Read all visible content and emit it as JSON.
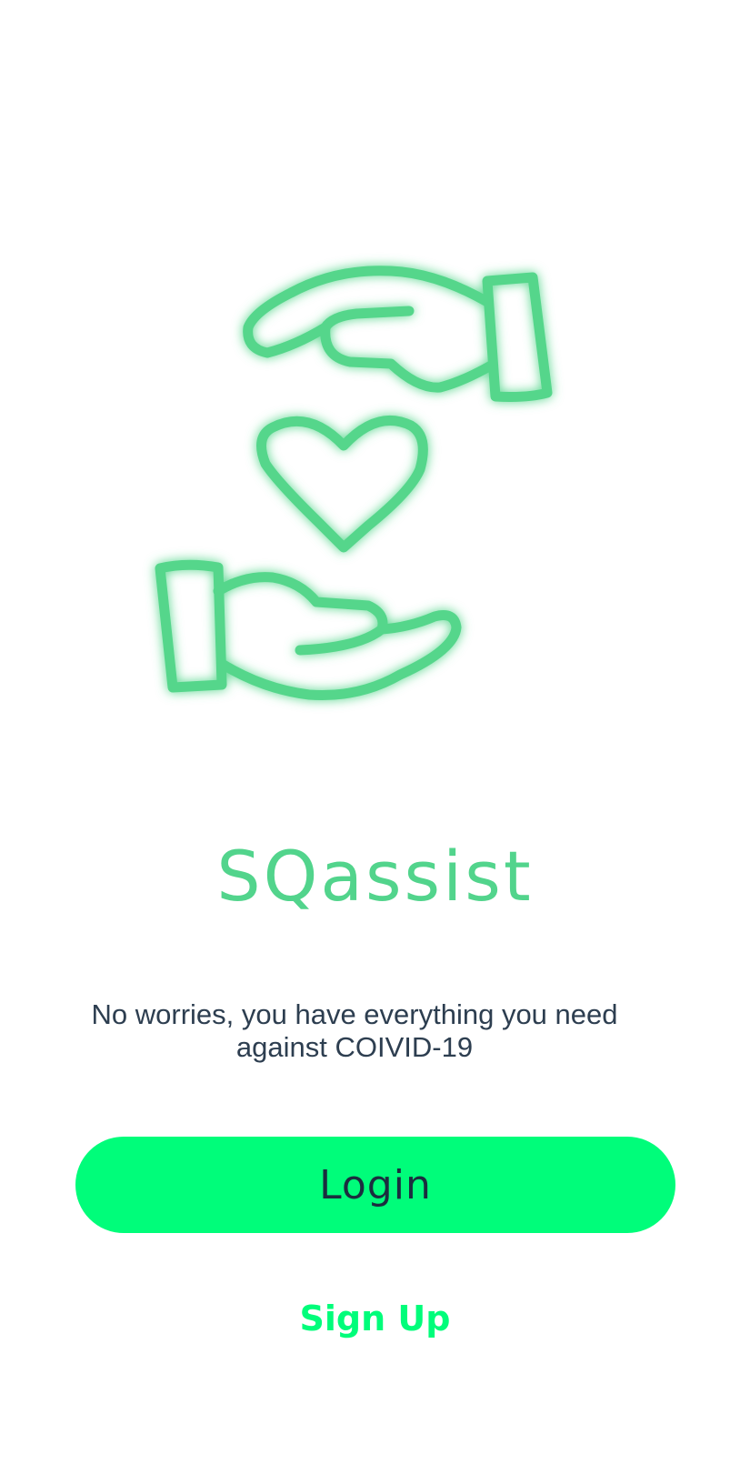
{
  "app": {
    "title": "SQassist",
    "tagline": "No worries, you have everything you need against COIVID-19"
  },
  "actions": {
    "login_label": "Login",
    "signup_label": "Sign Up"
  },
  "icons": {
    "illustration": "hands-holding-heart-icon"
  },
  "colors": {
    "accent": "#00fd7a",
    "title": "#52d48c",
    "illustration_stroke": "#55d68b",
    "tagline_text": "#2d3e50",
    "button_text": "#1b2d3f",
    "background": "#ffffff"
  }
}
